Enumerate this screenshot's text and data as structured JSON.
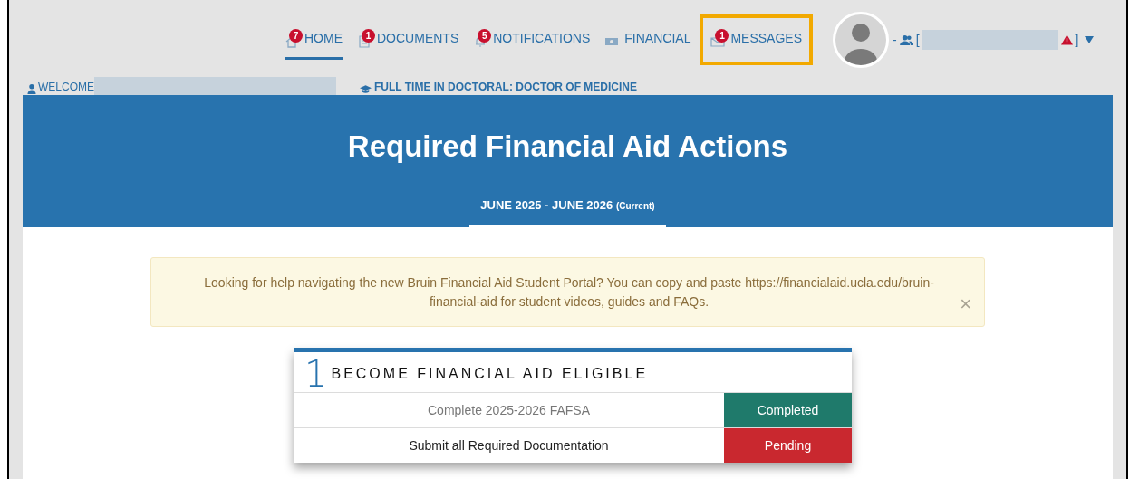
{
  "nav": [
    {
      "badge": "7",
      "label": "HOME",
      "selected": true,
      "highlighted": false
    },
    {
      "badge": "1",
      "label": "DOCUMENTS",
      "selected": false,
      "highlighted": false
    },
    {
      "badge": "5",
      "label": "NOTIFICATIONS",
      "selected": false,
      "highlighted": false
    },
    {
      "label": "FINANCIAL",
      "selected": false,
      "highlighted": false
    },
    {
      "badge": "1",
      "label": "MESSAGES",
      "selected": false,
      "highlighted": true
    }
  ],
  "user": {
    "prefix": "-",
    "open_bracket": "[",
    "close_bracket": "]",
    "warning": true
  },
  "welcome": {
    "label": "WELCOME"
  },
  "program": {
    "label": "FULL TIME IN DOCTORAL: DOCTOR OF MEDICINE"
  },
  "banner": {
    "title": "Required Financial Aid Actions",
    "tabs": [
      {
        "label": "JUNE 2025 - JUNE 2026",
        "note": "(Current)",
        "selected": true
      }
    ]
  },
  "alert": {
    "text": "Looking for help navigating the new Bruin Financial Aid Student Portal? You can copy and paste https://financialaid.ucla.edu/bruin-financial-aid for student videos, guides and FAQs.",
    "close": "×"
  },
  "step": {
    "number": "1",
    "title": "BECOME FINANCIAL AID ELIGIBLE",
    "rows": [
      {
        "task": "Complete 2025-2026 FAFSA",
        "status": "Completed",
        "kind": "completed"
      },
      {
        "task": "Submit all Required Documentation",
        "status": "Pending",
        "kind": "pending"
      }
    ]
  }
}
